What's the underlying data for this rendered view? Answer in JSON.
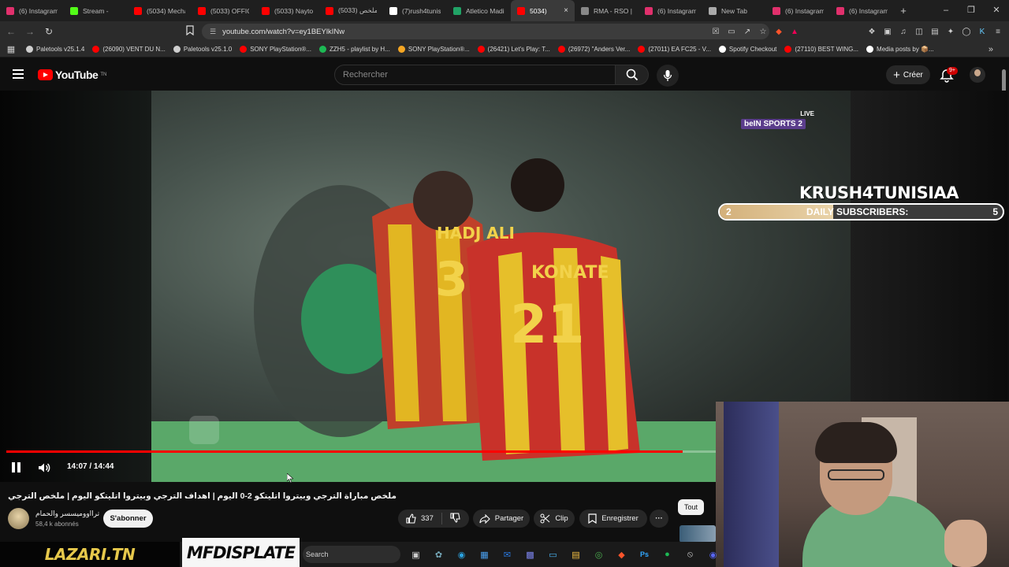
{
  "browser": {
    "tabs": [
      {
        "label": "(6) Instagram",
        "color": "#e1306c"
      },
      {
        "label": "Stream - ",
        "color": "#53fc18"
      },
      {
        "label": "(5034) Mecha",
        "color": "#ff0000"
      },
      {
        "label": "(5033) OFFICI",
        "color": "#ff0000"
      },
      {
        "label": "(5033) Nayto",
        "color": "#ff0000"
      },
      {
        "label": "(5033) ملخص",
        "color": "#ff0000"
      },
      {
        "label": "(7)rush4tunis",
        "color": "#ffffff"
      },
      {
        "label": "Atletico Madi",
        "color": "#21a366"
      },
      {
        "label": "5034)",
        "color": "#ff0000",
        "active": true
      },
      {
        "label": "RMA - RSO |",
        "color": "#888888"
      },
      {
        "label": "(6) Instagram",
        "color": "#e1306c"
      },
      {
        "label": "New Tab",
        "color": "#aaaaaa"
      },
      {
        "label": "(6) Instagram",
        "color": "#e1306c"
      },
      {
        "label": "(6) Instagram",
        "color": "#e1306c"
      }
    ],
    "url": "youtube.com/watch?v=ey1BEYlkINw",
    "bookmarks": [
      {
        "label": "Paletools v25.1.4",
        "color": "#cfcfcf"
      },
      {
        "label": "(26090) VENT DU N...",
        "color": "#ff0000"
      },
      {
        "label": "Paletools v25.1.0",
        "color": "#cfcfcf"
      },
      {
        "label": "SONY PlayStation®...",
        "color": "#ff0000"
      },
      {
        "label": "ZZH5 - playlist by H...",
        "color": "#1db954"
      },
      {
        "label": "SONY PlayStation®...",
        "color": "#f5a623"
      },
      {
        "label": "(26421) Let's Play: T...",
        "color": "#ff0000"
      },
      {
        "label": "(26972) \"Anders Ver...",
        "color": "#ff0000"
      },
      {
        "label": "(27011) EA FC25 - V...",
        "color": "#ff0000"
      },
      {
        "label": "Spotify Checkout",
        "color": "#ffffff"
      },
      {
        "label": "(27110) BEST WING...",
        "color": "#ff0000"
      },
      {
        "label": "Media posts by 📦...",
        "color": "#ffffff"
      }
    ]
  },
  "youtube": {
    "logo_text": "YouTube",
    "logo_sup": "TN",
    "search_placeholder": "Rechercher",
    "create_label": "Créer",
    "notif_badge": "9+"
  },
  "player": {
    "broadcaster_live": "LIVE",
    "broadcaster_logo": "beIN SPORTS 2",
    "overlay_channel": "KRUSH4TUNISIAA",
    "subs_goal_label": "DAILY SUBSCRIBERS:",
    "subs_current": "2",
    "subs_goal": "5",
    "subs_progress": 0.4,
    "progress_fraction": 0.953,
    "timecode": "14:07 / 14:44"
  },
  "video": {
    "title": "ملخص مباراة الترجي وبيتروا اتليتكو 2-0 اليوم | اهداف الترجي وبيتروا اتليتكو اليوم | ملخص الترجي",
    "channel_name": "ترااووميسسر والحمام",
    "channel_subs": "58,4 k abonnés",
    "subscribe_label": "S'abonner",
    "likes": "337",
    "share_label": "Partager",
    "clip_label": "Clip",
    "save_label": "Enregistrer",
    "more_label": "···",
    "chip_all": "Tout"
  },
  "overlay": {
    "brand_left": "LAZARI.TN",
    "brand_center": "MFDISPLATE"
  },
  "taskbar": {
    "search_label": "Search"
  }
}
